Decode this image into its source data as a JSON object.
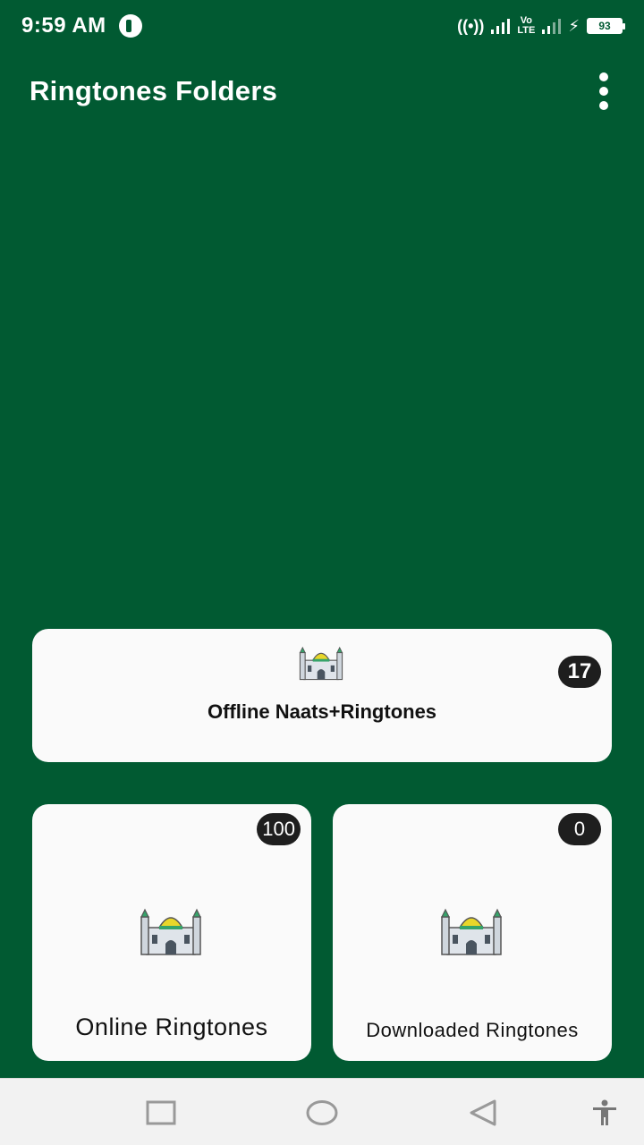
{
  "status_bar": {
    "time": "9:59 AM",
    "volte": "Vo\nLTE",
    "battery": "93",
    "icons": [
      "hotspot-icon",
      "signal-icon",
      "volte-icon",
      "signal-icon",
      "charging-icon",
      "battery-icon"
    ]
  },
  "app_bar": {
    "title": "Ringtones Folders",
    "menu_icon": "more-vertical-icon"
  },
  "cards": {
    "offline": {
      "label": "Offline Naats+Ringtones",
      "count": "17",
      "icon": "mosque-icon"
    },
    "online": {
      "label": "Online Ringtones",
      "count": "100",
      "icon": "mosque-icon"
    },
    "downloaded": {
      "label": "Downloaded Ringtones",
      "count": "0",
      "icon": "mosque-icon"
    }
  },
  "nav_bar": {
    "items": [
      "recent-apps-icon",
      "home-icon",
      "back-icon",
      "accessibility-icon"
    ]
  },
  "colors": {
    "background": "#015a32",
    "card": "#fafafa",
    "badge": "#1e1e1e",
    "nav_bar": "#f2f2f2"
  }
}
